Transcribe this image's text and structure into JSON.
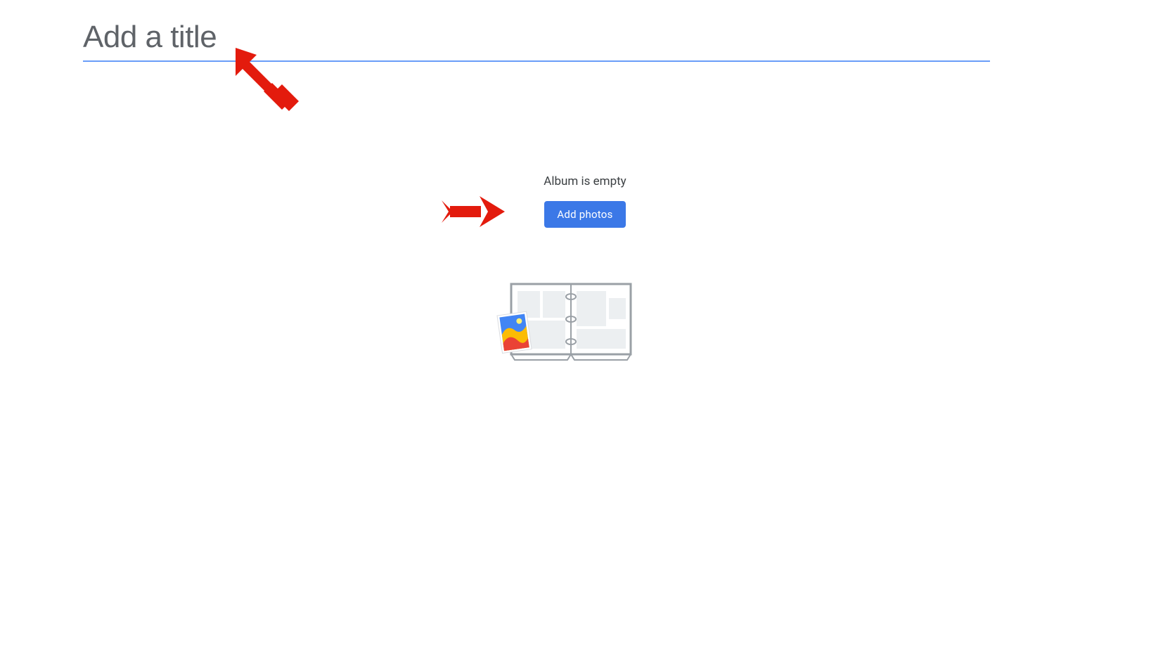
{
  "title": {
    "placeholder": "Add a title",
    "value": ""
  },
  "emptyState": {
    "message": "Album is empty",
    "buttonLabel": "Add photos"
  },
  "colors": {
    "accent": "#3b78e7",
    "underline": "#6a9df8",
    "text": "#5f6368",
    "annotation": "#e31b0d"
  }
}
